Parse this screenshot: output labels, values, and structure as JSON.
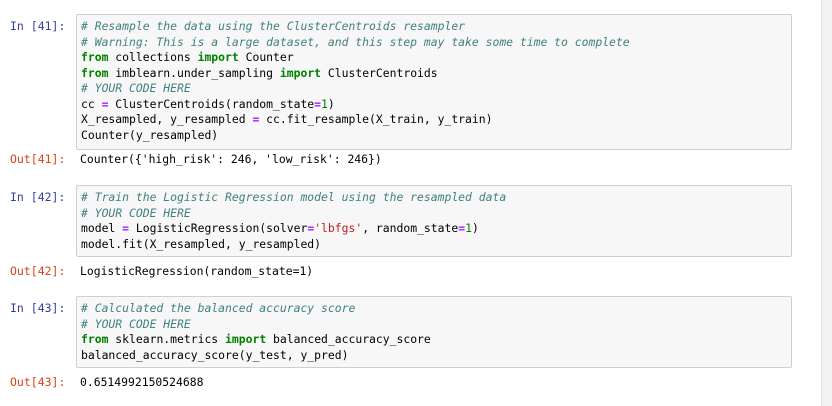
{
  "cells": [
    {
      "in_prompt": "In [41]:",
      "code_lines": [
        [
          {
            "t": "# Resample the data using the ClusterCentroids resampler",
            "c": "cm"
          }
        ],
        [
          {
            "t": "# Warning: This is a large dataset, and this step may take some time to complete",
            "c": "cm"
          }
        ],
        [
          {
            "t": "from",
            "c": "kw"
          },
          {
            "t": " collections "
          },
          {
            "t": "import",
            "c": "kw"
          },
          {
            "t": " Counter"
          }
        ],
        [
          {
            "t": "from",
            "c": "kw"
          },
          {
            "t": " imblearn.under_sampling "
          },
          {
            "t": "import",
            "c": "kw"
          },
          {
            "t": " ClusterCentroids"
          }
        ],
        [
          {
            "t": "# YOUR CODE HERE",
            "c": "cm"
          }
        ],
        [
          {
            "t": "cc "
          },
          {
            "t": "=",
            "c": "op"
          },
          {
            "t": " ClusterCentroids(random_state"
          },
          {
            "t": "=",
            "c": "op"
          },
          {
            "t": "1",
            "c": "num"
          },
          {
            "t": ")"
          }
        ],
        [
          {
            "t": "X_resampled, y_resampled "
          },
          {
            "t": "=",
            "c": "op"
          },
          {
            "t": " cc.fit_resample(X_train, y_train)"
          }
        ],
        [
          {
            "t": "Counter(y_resampled)"
          }
        ]
      ],
      "out_prompt": "Out[41]:",
      "output": "Counter({'high_risk': 246, 'low_risk': 246})"
    },
    {
      "in_prompt": "In [42]:",
      "code_lines": [
        [
          {
            "t": "# Train the Logistic Regression model using the resampled data",
            "c": "cm"
          }
        ],
        [
          {
            "t": "# YOUR CODE HERE",
            "c": "cm"
          }
        ],
        [
          {
            "t": "model "
          },
          {
            "t": "=",
            "c": "op"
          },
          {
            "t": " LogisticRegression(solver"
          },
          {
            "t": "=",
            "c": "op"
          },
          {
            "t": "'lbfgs'",
            "c": "str"
          },
          {
            "t": ", random_state"
          },
          {
            "t": "=",
            "c": "op"
          },
          {
            "t": "1",
            "c": "num"
          },
          {
            "t": ")"
          }
        ],
        [
          {
            "t": "model.fit(X_resampled, y_resampled)"
          }
        ]
      ],
      "out_prompt": "Out[42]:",
      "output": "LogisticRegression(random_state=1)"
    },
    {
      "in_prompt": "In [43]:",
      "code_lines": [
        [
          {
            "t": "# Calculated the balanced accuracy score",
            "c": "cm"
          }
        ],
        [
          {
            "t": "# YOUR CODE HERE",
            "c": "cm"
          }
        ],
        [
          {
            "t": "from",
            "c": "kw"
          },
          {
            "t": " sklearn.metrics "
          },
          {
            "t": "import",
            "c": "kw"
          },
          {
            "t": " balanced_accuracy_score"
          }
        ],
        [
          {
            "t": "balanced_accuracy_score(y_test, y_pred)"
          }
        ]
      ],
      "out_prompt": "Out[43]:",
      "output": "0.6514992150524688"
    }
  ]
}
